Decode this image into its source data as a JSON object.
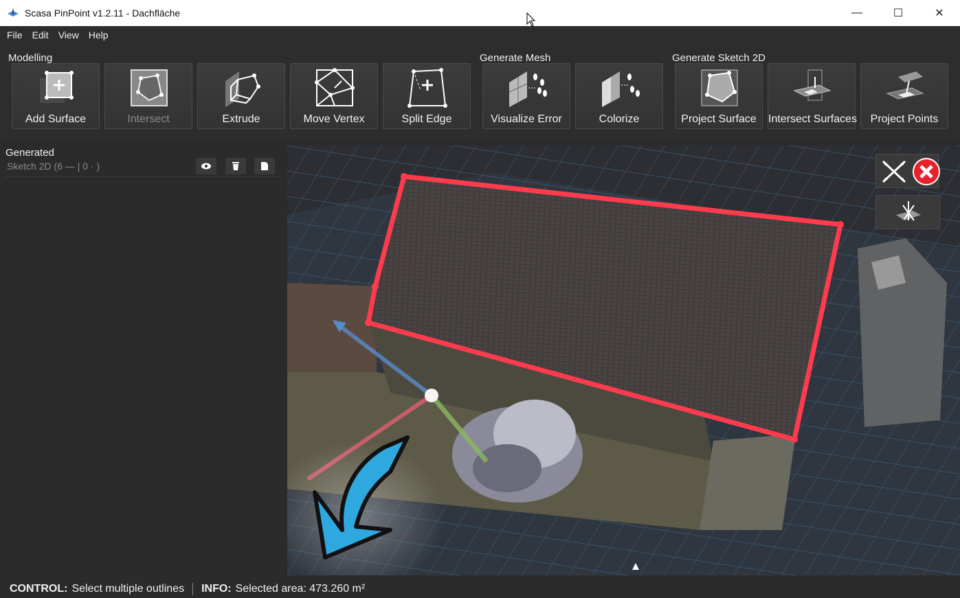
{
  "window": {
    "title": "Scasa PinPoint v1.2.11 - Dachfläche",
    "minimize": "—",
    "maximize": "☐",
    "close": "✕"
  },
  "menu": [
    "File",
    "Edit",
    "View",
    "Help"
  ],
  "toolbar": {
    "groups": [
      {
        "label": "Modelling"
      },
      {
        "label": "Generate Mesh"
      },
      {
        "label": "Generate Sketch 2D"
      }
    ],
    "buttons": [
      {
        "label": "Add Surface",
        "icon": "add-surface-icon",
        "enabled": true
      },
      {
        "label": "Intersect",
        "icon": "intersect-icon",
        "enabled": false
      },
      {
        "label": "Extrude",
        "icon": "extrude-icon",
        "enabled": true
      },
      {
        "label": "Move Vertex",
        "icon": "move-vertex-icon",
        "enabled": true
      },
      {
        "label": "Split Edge",
        "icon": "split-edge-icon",
        "enabled": true
      },
      {
        "label": "Visualize Error",
        "icon": "visualize-error-icon",
        "enabled": true
      },
      {
        "label": "Colorize",
        "icon": "colorize-icon",
        "enabled": true
      },
      {
        "label": "Project Surface",
        "icon": "project-surface-icon",
        "enabled": true
      },
      {
        "label": "Intersect Surfaces",
        "icon": "intersect-surfaces-icon",
        "enabled": true
      },
      {
        "label": "Project Points",
        "icon": "project-points-icon",
        "enabled": true
      }
    ]
  },
  "panel": {
    "header": "Generated",
    "items": [
      {
        "label": "Sketch 2D (6 — | 0 · )"
      }
    ]
  },
  "status": {
    "control_key": "CONTROL:",
    "control_text": "Select multiple outlines",
    "info_key": "INFO:",
    "info_text": "Selected area: 473.260 m²"
  },
  "colors": {
    "outline": "#ff3b4e",
    "arrow": "#2fa8e0",
    "cancel": "#e8202a",
    "grid": "#3b5f7d"
  }
}
